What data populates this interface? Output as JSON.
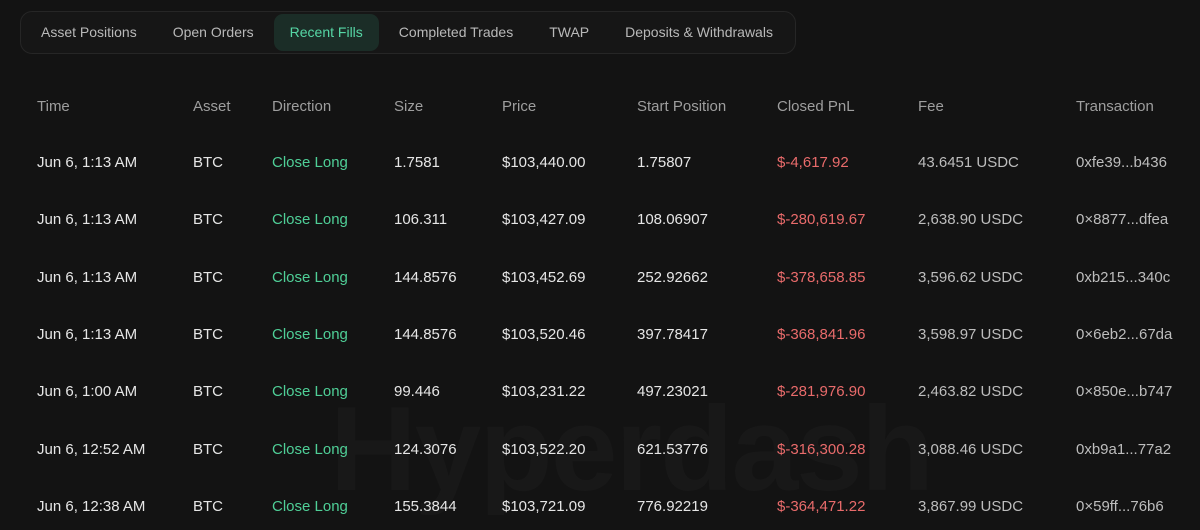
{
  "tabs": [
    {
      "label": "Asset Positions",
      "active": false
    },
    {
      "label": "Open Orders",
      "active": false
    },
    {
      "label": "Recent Fills",
      "active": true
    },
    {
      "label": "Completed Trades",
      "active": false
    },
    {
      "label": "TWAP",
      "active": false
    },
    {
      "label": "Deposits & Withdrawals",
      "active": false
    }
  ],
  "columns": [
    "Time",
    "Asset",
    "Direction",
    "Size",
    "Price",
    "Start Position",
    "Closed PnL",
    "Fee",
    "Transaction"
  ],
  "rows": [
    {
      "time": "Jun 6, 1:13 AM",
      "asset": "BTC",
      "direction": "Close Long",
      "size": "1.7581",
      "price": "$103,440.00",
      "start_position": "1.75807",
      "closed_pnl": "$-4,617.92",
      "fee": "43.6451 USDC",
      "transaction": "0xfe39...b436"
    },
    {
      "time": "Jun 6, 1:13 AM",
      "asset": "BTC",
      "direction": "Close Long",
      "size": "106.311",
      "price": "$103,427.09",
      "start_position": "108.06907",
      "closed_pnl": "$-280,619.67",
      "fee": "2,638.90 USDC",
      "transaction": "0×8877...dfea"
    },
    {
      "time": "Jun 6, 1:13 AM",
      "asset": "BTC",
      "direction": "Close Long",
      "size": "144.8576",
      "price": "$103,452.69",
      "start_position": "252.92662",
      "closed_pnl": "$-378,658.85",
      "fee": "3,596.62 USDC",
      "transaction": "0xb215...340c"
    },
    {
      "time": "Jun 6, 1:13 AM",
      "asset": "BTC",
      "direction": "Close Long",
      "size": "144.8576",
      "price": "$103,520.46",
      "start_position": "397.78417",
      "closed_pnl": "$-368,841.96",
      "fee": "3,598.97 USDC",
      "transaction": "0×6eb2...67da"
    },
    {
      "time": "Jun 6, 1:00 AM",
      "asset": "BTC",
      "direction": "Close Long",
      "size": "99.446",
      "price": "$103,231.22",
      "start_position": "497.23021",
      "closed_pnl": "$-281,976.90",
      "fee": "2,463.82 USDC",
      "transaction": "0×850e...b747"
    },
    {
      "time": "Jun 6, 12:52 AM",
      "asset": "BTC",
      "direction": "Close Long",
      "size": "124.3076",
      "price": "$103,522.20",
      "start_position": "621.53776",
      "closed_pnl": "$-316,300.28",
      "fee": "3,088.46 USDC",
      "transaction": "0xb9a1...77a2"
    },
    {
      "time": "Jun 6, 12:38 AM",
      "asset": "BTC",
      "direction": "Close Long",
      "size": "155.3844",
      "price": "$103,721.09",
      "start_position": "776.92219",
      "closed_pnl": "$-364,471.22",
      "fee": "3,867.99 USDC",
      "transaction": "0×59ff...76b6"
    }
  ],
  "colors": {
    "accent": "#56d6a5",
    "direction": "#4fcf97",
    "pnl_negative": "#e96b6b",
    "background": "#131313"
  }
}
